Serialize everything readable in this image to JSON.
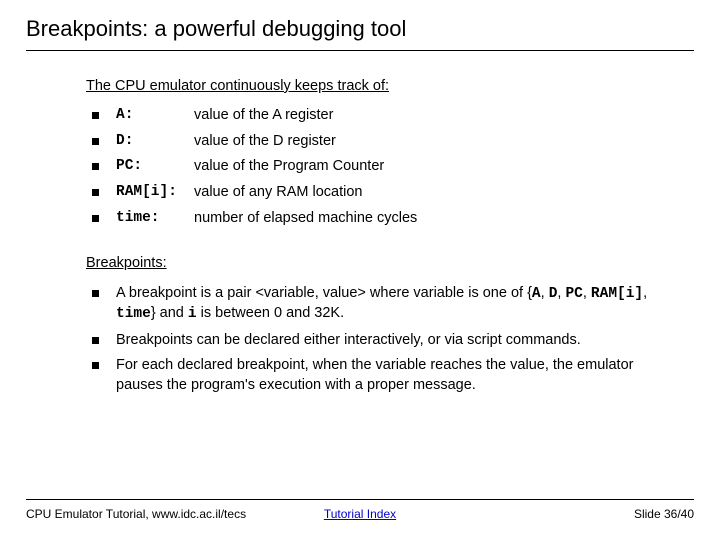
{
  "title": "Breakpoints: a powerful debugging tool",
  "tracking": {
    "heading": "The CPU emulator continuously keeps track of:",
    "items": [
      {
        "key": "A:",
        "desc": "value of the A register"
      },
      {
        "key": "D:",
        "desc": "value of the D register"
      },
      {
        "key": "PC:",
        "desc": "value of the Program Counter"
      },
      {
        "key": "RAM[i]:",
        "desc": "value of any RAM location"
      },
      {
        "key": "time:",
        "desc": "number of elapsed machine cycles"
      }
    ]
  },
  "breakpoints": {
    "heading": "Breakpoints:",
    "items": [
      {
        "pre": "A breakpoint is a pair <variable, value> where variable is one of {",
        "codes": [
          "A",
          "D",
          "PC",
          "RAM[i]",
          "time"
        ],
        "mid": "} and ",
        "codemid": "i",
        "post": " is between 0 and 32K."
      },
      {
        "text": "Breakpoints can be declared either interactively, or via script commands."
      },
      {
        "text": "For each declared breakpoint, when the variable reaches the value, the emulator pauses the program's execution with a proper message."
      }
    ]
  },
  "footer": {
    "left": "CPU Emulator Tutorial, www.idc.ac.il/tecs",
    "center": "Tutorial Index",
    "right": "Slide 36/40"
  }
}
